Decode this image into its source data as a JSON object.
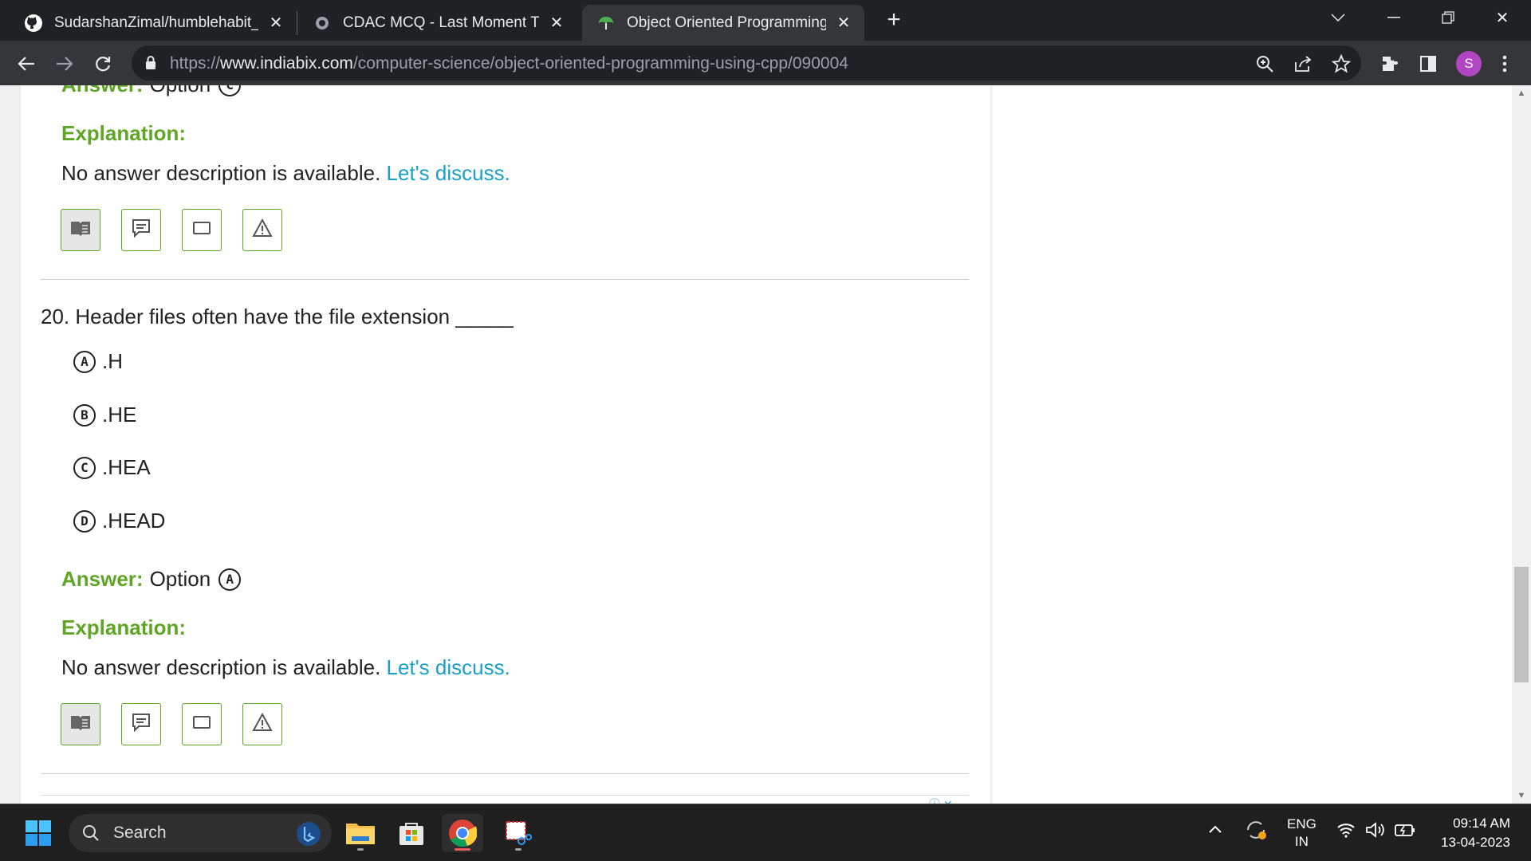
{
  "browser": {
    "tabs": [
      {
        "title": "SudarshanZimal/humblehabit_C++",
        "active": false
      },
      {
        "title": "CDAC MCQ - Last Moment Tuitions",
        "active": false
      },
      {
        "title": "Object Oriented Programming Using C++",
        "active": true
      }
    ],
    "url_prefix": "https://",
    "url_host": "www.indiabix.com",
    "url_path": "/computer-science/object-oriented-programming-using-cpp/090004",
    "profile_initial": "S"
  },
  "page": {
    "prev_answer": {
      "label": "Answer:",
      "text": "Option",
      "letter": "C"
    },
    "prev_explanation": {
      "title": "Explanation:",
      "text": "No answer description is available.",
      "link": "Let's discuss."
    },
    "question": {
      "number": "20.",
      "text": "Header files often have the file extension _____",
      "options": [
        {
          "letter": "A",
          "text": ".H"
        },
        {
          "letter": "B",
          "text": ".HE"
        },
        {
          "letter": "C",
          "text": ".HEA"
        },
        {
          "letter": "D",
          "text": ".HEAD"
        }
      ],
      "answer": {
        "label": "Answer:",
        "text": "Option",
        "letter": "A"
      },
      "explanation": {
        "title": "Explanation:",
        "text": "No answer description is available.",
        "link": "Let's discuss."
      }
    },
    "accent_color": "#5fa624",
    "link_color": "#1aa0c6"
  },
  "taskbar": {
    "search_placeholder": "Search",
    "lang_top": "ENG",
    "lang_bottom": "IN",
    "time": "09:14 AM",
    "date": "13-04-2023"
  }
}
